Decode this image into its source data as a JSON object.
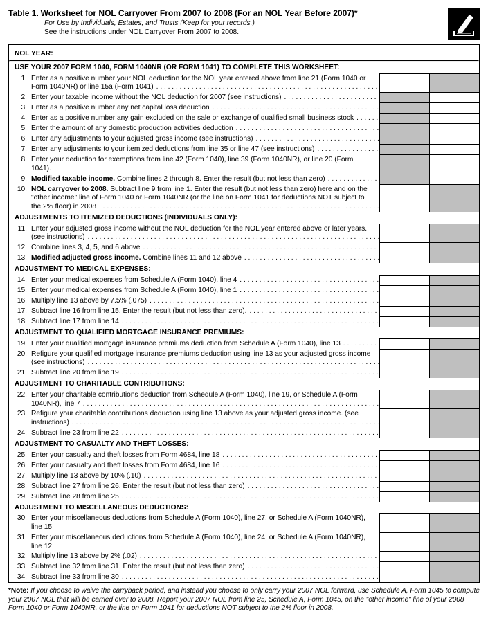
{
  "header": {
    "table_label": "Table 1.",
    "title": "Worksheet for NOL Carryover From 2007 to 2008 (For an NOL Year Before 2007)*",
    "subtitle1": "For Use by Individuals, Estates, and Trusts (Keep for your records.)",
    "subtitle2": "See the instructions under NOL Carryover From 2007 to 2008."
  },
  "nol_year_label": "NOL YEAR:",
  "use_heading": "USE YOUR 2007 FORM 1040, FORM 1040NR (OR FORM 1041) TO COMPLETE THIS WORKSHEET:",
  "lines_top": [
    {
      "n": "1.",
      "t": "Enter as a positive number your NOL deduction for the NOL year entered above from line 21 (Form 1040 or Form 1040NR) or line 15a (Form 1041)",
      "shade": [
        false,
        true
      ]
    },
    {
      "n": "2.",
      "t": "Enter your taxable income without the NOL deduction for 2007 (see instructions)",
      "shade": [
        true,
        false
      ]
    },
    {
      "n": "3.",
      "t": "Enter as a positive number any net capital loss deduction",
      "shade": [
        true,
        false
      ]
    },
    {
      "n": "4.",
      "t": "Enter as a positive number any gain excluded on the sale or exchange of qualified small business stock",
      "shade": [
        true,
        false
      ]
    },
    {
      "n": "5.",
      "t": "Enter the amount of any domestic production activities deduction",
      "shade": [
        true,
        false
      ]
    },
    {
      "n": "6.",
      "t": "Enter any adjustments to your adjusted gross income (see instructions)",
      "shade": [
        true,
        false
      ]
    },
    {
      "n": "7.",
      "t": "Enter any adjustments to your itemized deductions from line 35 or line 47 (see instructions)",
      "shade": [
        true,
        false
      ]
    },
    {
      "n": "8.",
      "t": "Enter your deduction for exemptions from line 42 (Form 1040), line 39 (Form 1040NR), or line 20 (Form 1041).",
      "shade": [
        true,
        false
      ],
      "noleader": true
    },
    {
      "n": "9.",
      "bold": "Modified taxable income.",
      "t": " Combine lines 2 through 8. Enter the result (but not less than zero)",
      "shade": [
        true,
        false
      ]
    },
    {
      "n": "10.",
      "bold": "NOL carryover to 2008.",
      "t": " Subtract line 9 from line 1. Enter the result (but not less than zero) here and on the \"other income\" line of Form 1040 or Form 1040NR (or the line on Form 1041 for deductions NOT subject to the 2% floor) in 2008",
      "shade": [
        false,
        true
      ]
    }
  ],
  "adj_itemized_head": "ADJUSTMENTS TO ITEMIZED DEDUCTIONS (INDIVIDUALS ONLY):",
  "lines_itemized": [
    {
      "n": "11.",
      "t": "Enter your adjusted gross income without the NOL deduction for the NOL year entered above or later years. (see instructions)",
      "shade": [
        false,
        true
      ]
    },
    {
      "n": "12.",
      "t": "Combine lines 3, 4, 5, and 6 above",
      "shade": [
        false,
        true
      ]
    },
    {
      "n": "13.",
      "bold": "Modified adjusted gross income.",
      "t": " Combine lines 11 and 12 above",
      "shade": [
        false,
        true
      ]
    }
  ],
  "adj_medical_head": "ADJUSTMENT TO MEDICAL EXPENSES:",
  "lines_medical": [
    {
      "n": "14.",
      "t": "Enter your medical expenses from Schedule A (Form 1040), line 4",
      "shade": [
        false,
        true
      ]
    },
    {
      "n": "15.",
      "t": "Enter your medical expenses from Schedule A (Form 1040), line 1",
      "shade": [
        false,
        true
      ]
    },
    {
      "n": "16.",
      "t": "Multiply line 13 above by 7.5% (.075)",
      "shade": [
        false,
        true
      ]
    },
    {
      "n": "17.",
      "t": "Subtract line 16 from line 15. Enter the result (but not less than zero).",
      "shade": [
        false,
        true
      ]
    },
    {
      "n": "18.",
      "t": "Subtract line 17 from line 14",
      "shade": [
        false,
        true
      ]
    }
  ],
  "adj_mortgage_head": "ADJUSTMENT TO QUALIFIED MORTGAGE INSURANCE PREMIUMS:",
  "lines_mortgage": [
    {
      "n": "19.",
      "t": "Enter your qualified mortgage insurance premiums deduction from Schedule A (Form 1040), line 13",
      "shade": [
        false,
        true
      ]
    },
    {
      "n": "20.",
      "t": "Refigure your qualified mortgage insurance premiums deduction using line 13 as your adjusted gross income (see instructions)",
      "shade": [
        false,
        true
      ]
    },
    {
      "n": "21.",
      "t": "Subtract line 20 from line 19",
      "shade": [
        false,
        true
      ]
    }
  ],
  "adj_charitable_head": "ADJUSTMENT TO CHARITABLE CONTRIBUTIONS:",
  "lines_charitable": [
    {
      "n": "22.",
      "t": "Enter your charitable contributions deduction from Schedule A (Form 1040), line 19, or Schedule A (Form 1040NR), line 7",
      "shade": [
        false,
        true
      ]
    },
    {
      "n": "23.",
      "t": "Refigure your charitable contributions deduction using line 13 above as your adjusted gross income. (see instructions)",
      "shade": [
        false,
        true
      ]
    },
    {
      "n": "24.",
      "t": "Subtract line 23 from line 22",
      "shade": [
        false,
        true
      ]
    }
  ],
  "adj_casualty_head": "ADJUSTMENT TO CASUALTY AND THEFT LOSSES:",
  "lines_casualty": [
    {
      "n": "25.",
      "t": "Enter your casualty and theft losses from Form 4684, line 18",
      "shade": [
        false,
        true
      ]
    },
    {
      "n": "26.",
      "t": "Enter your casualty and theft losses from Form 4684, line 16",
      "shade": [
        false,
        true
      ]
    },
    {
      "n": "27.",
      "t": "Multiply line 13 above by 10% (.10)",
      "shade": [
        false,
        true
      ]
    },
    {
      "n": "28.",
      "t": "Subtract line 27 from line 26. Enter the result (but not less than zero)",
      "shade": [
        false,
        true
      ]
    },
    {
      "n": "29.",
      "t": "Subtract line 28 from line 25",
      "shade": [
        false,
        true
      ]
    }
  ],
  "adj_misc_head": "ADJUSTMENT TO MISCELLANEOUS DEDUCTIONS:",
  "lines_misc": [
    {
      "n": "30.",
      "t": "Enter your miscellaneous deductions from Schedule A (Form 1040), line 27, or Schedule A (Form 1040NR), line 15",
      "shade": [
        false,
        true
      ],
      "noleader": true
    },
    {
      "n": "31.",
      "t": "Enter your miscellaneous deductions from Schedule A (Form 1040), line 24, or Schedule A (Form 1040NR), line 12",
      "shade": [
        false,
        true
      ],
      "noleader": true
    },
    {
      "n": "32.",
      "t": "Multiply line 13 above by 2% (.02)",
      "shade": [
        false,
        true
      ]
    },
    {
      "n": "33.",
      "t": "Subtract line 32 from line 31. Enter the result (but not less than zero)",
      "shade": [
        false,
        true
      ]
    },
    {
      "n": "34.",
      "t": "Subtract line 33 from line 30",
      "shade": [
        false,
        true
      ]
    }
  ],
  "footnote_label": "*Note:",
  "footnote": " If you choose to waive the carryback period, and instead you choose to only carry your 2007 NOL forward, use Schedule A, Form 1045 to compute your 2007 NOL that will be carried over to 2008. Report your 2007 NOL from line 25, Schedule A, Form 1045, on the \"other income\" line of your 2008 Form 1040 or Form 1040NR, or the line on Form 1041 for deductions NOT subject to the 2% floor in 2008."
}
